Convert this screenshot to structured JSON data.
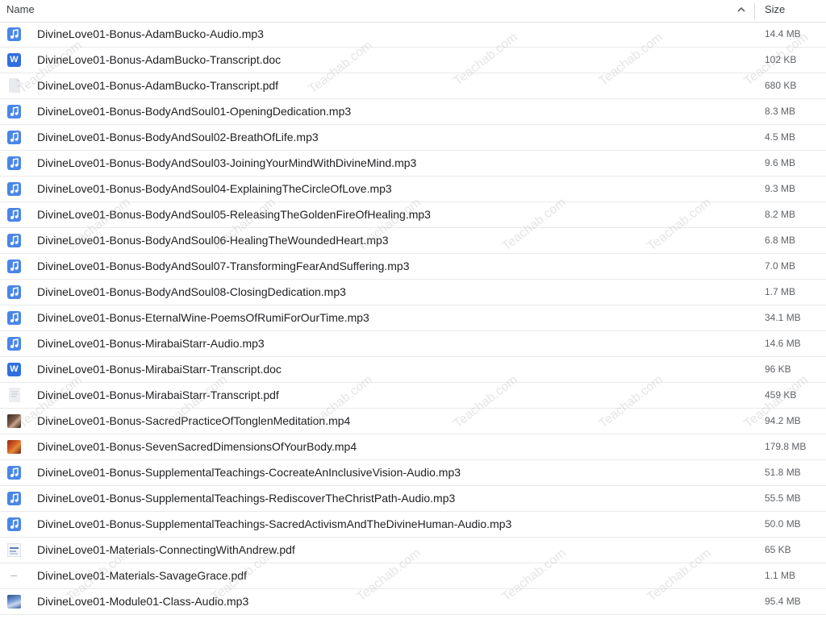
{
  "header": {
    "name_label": "Name",
    "size_label": "Size"
  },
  "watermark_text": "Teachab.com",
  "files": [
    {
      "name": "DivineLove01-Bonus-AdamBucko-Audio.mp3",
      "size": "14.4 MB",
      "icon": "audio-file-icon"
    },
    {
      "name": "DivineLove01-Bonus-AdamBucko-Transcript.doc",
      "size": "102 KB",
      "icon": "word-document-icon"
    },
    {
      "name": "DivineLove01-Bonus-AdamBucko-Transcript.pdf",
      "size": "680 KB",
      "icon": "pdf-file-icon"
    },
    {
      "name": "DivineLove01-Bonus-BodyAndSoul01-OpeningDedication.mp3",
      "size": "8.3 MB",
      "icon": "audio-file-icon"
    },
    {
      "name": "DivineLove01-Bonus-BodyAndSoul02-BreathOfLife.mp3",
      "size": "4.5 MB",
      "icon": "audio-file-icon"
    },
    {
      "name": "DivineLove01-Bonus-BodyAndSoul03-JoiningYourMindWithDivineMind.mp3",
      "size": "9.6 MB",
      "icon": "audio-file-icon"
    },
    {
      "name": "DivineLove01-Bonus-BodyAndSoul04-ExplainingTheCircleOfLove.mp3",
      "size": "9.3 MB",
      "icon": "audio-file-icon"
    },
    {
      "name": "DivineLove01-Bonus-BodyAndSoul05-ReleasingTheGoldenFireOfHealing.mp3",
      "size": "8.2 MB",
      "icon": "audio-file-icon"
    },
    {
      "name": "DivineLove01-Bonus-BodyAndSoul06-HealingTheWoundedHeart.mp3",
      "size": "6.8 MB",
      "icon": "audio-file-icon"
    },
    {
      "name": "DivineLove01-Bonus-BodyAndSoul07-TransformingFearAndSuffering.mp3",
      "size": "7.0 MB",
      "icon": "audio-file-icon"
    },
    {
      "name": "DivineLove01-Bonus-BodyAndSoul08-ClosingDedication.mp3",
      "size": "1.7 MB",
      "icon": "audio-file-icon"
    },
    {
      "name": "DivineLove01-Bonus-EternalWine-PoemsOfRumiForOurTime.mp3",
      "size": "34.1 MB",
      "icon": "audio-file-icon"
    },
    {
      "name": "DivineLove01-Bonus-MirabaiStarr-Audio.mp3",
      "size": "14.6 MB",
      "icon": "audio-file-icon"
    },
    {
      "name": "DivineLove01-Bonus-MirabaiStarr-Transcript.doc",
      "size": "96 KB",
      "icon": "word-document-icon"
    },
    {
      "name": "DivineLove01-Bonus-MirabaiStarr-Transcript.pdf",
      "size": "459 KB",
      "icon": "pdf-file-icon"
    },
    {
      "name": "DivineLove01-Bonus-SacredPracticeOfTonglenMeditation.mp4",
      "size": "94.2 MB",
      "icon": "video-thumbnail-icon"
    },
    {
      "name": "DivineLove01-Bonus-SevenSacredDimensionsOfYourBody.mp4",
      "size": "179.8 MB",
      "icon": "video-thumbnail-icon"
    },
    {
      "name": "DivineLove01-Bonus-SupplementalTeachings-CocreateAnInclusiveVision-Audio.mp3",
      "size": "51.8 MB",
      "icon": "audio-file-icon"
    },
    {
      "name": "DivineLove01-Bonus-SupplementalTeachings-RediscoverTheChristPath-Audio.mp3",
      "size": "55.5 MB",
      "icon": "audio-file-icon"
    },
    {
      "name": "DivineLove01-Bonus-SupplementalTeachings-SacredActivismAndTheDivineHuman-Audio.mp3",
      "size": "50.0 MB",
      "icon": "audio-file-icon"
    },
    {
      "name": "DivineLove01-Materials-ConnectingWithAndrew.pdf",
      "size": "65 KB",
      "icon": "pdf-thumbnail-icon"
    },
    {
      "name": "DivineLove01-Materials-SavageGrace.pdf",
      "size": "1.1 MB",
      "icon": "pdf-thumbnail-icon"
    },
    {
      "name": "DivineLove01-Module01-Class-Audio.mp3",
      "size": "95.4 MB",
      "icon": "audio-thumbnail-icon"
    }
  ],
  "colors": {
    "audio_icon": "#4a86e8",
    "doc_icon": "#2f6fe0",
    "row_divider": "#e8eaed"
  }
}
